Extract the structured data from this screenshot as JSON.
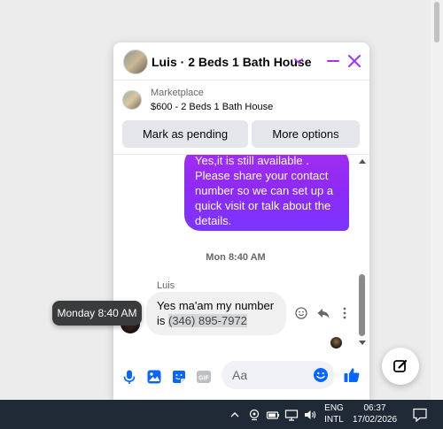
{
  "chat": {
    "title": "Luis · 2 Beds 1 Bath House",
    "marketplace_label": "Marketplace",
    "listing": "$600 - 2 Beds 1 Bath House",
    "mark_pending_label": "Mark as pending",
    "more_options_label": "More options"
  },
  "messages": {
    "outgoing_text": "Yes,it is still available . Please share your contact number so we can set up a quick visit or talk about the details.",
    "time_separator": "Mon 8:40 AM",
    "sender_name": "Luis",
    "incoming_prefix": "Yes ma'am my number is ",
    "incoming_phone": "(346) 895-7972",
    "tooltip": "Monday 8:40 AM"
  },
  "composer": {
    "placeholder": "Aa"
  },
  "taskbar": {
    "lang_top": "ENG",
    "lang_bottom": "INTL",
    "time": "06:37",
    "date": "17/02/2026"
  },
  "colors": {
    "accent": "#a033ff",
    "facebook_blue": "#0866ff"
  }
}
